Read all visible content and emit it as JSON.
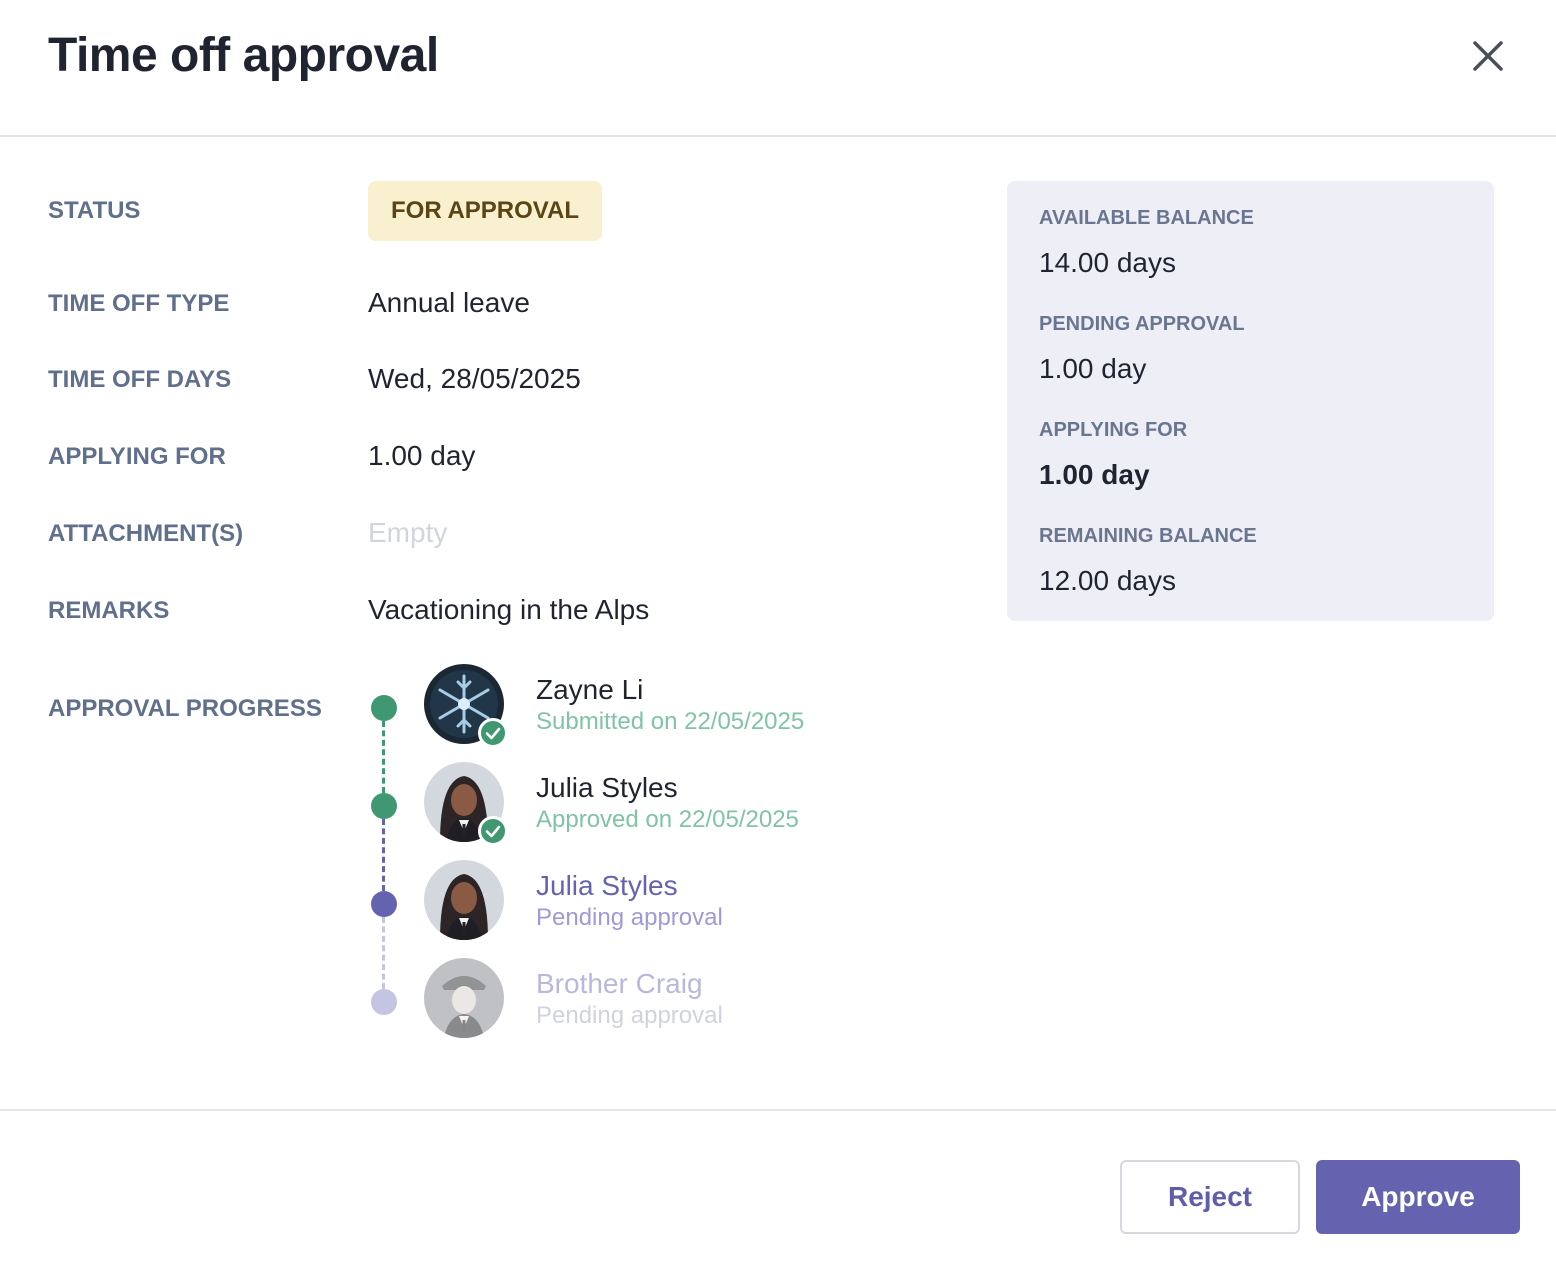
{
  "dialog": {
    "title": "Time off approval"
  },
  "fields": {
    "status_label": "STATUS",
    "status_value": "FOR APPROVAL",
    "type_label": "TIME OFF TYPE",
    "type_value": "Annual leave",
    "days_label": "TIME OFF DAYS",
    "days_value": "Wed, 28/05/2025",
    "applying_label": "APPLYING FOR",
    "applying_value": "1.00 day",
    "attachments_label": "ATTACHMENT(S)",
    "attachments_value": "Empty",
    "remarks_label": "REMARKS",
    "remarks_value": "Vacationing in the Alps",
    "progress_label": "APPROVAL PROGRESS"
  },
  "balance": {
    "available_label": "AVAILABLE BALANCE",
    "available_value": "14.00 days",
    "pending_label": "PENDING APPROVAL",
    "pending_value": "1.00 day",
    "applying_label": "APPLYING FOR",
    "applying_value": "1.00 day",
    "remaining_label": "REMAINING BALANCE",
    "remaining_value": "12.00 days"
  },
  "approvers": [
    {
      "name": "Zayne Li",
      "status": "Submitted on 22/05/2025",
      "state": "done"
    },
    {
      "name": "Julia Styles",
      "status": "Approved on 22/05/2025",
      "state": "done"
    },
    {
      "name": "Julia Styles",
      "status": "Pending approval",
      "state": "current"
    },
    {
      "name": "Brother Craig",
      "status": "Pending approval",
      "state": "upcoming"
    }
  ],
  "actions": {
    "reject_label": "Reject",
    "approve_label": "Approve"
  },
  "colors": {
    "done": "#3f9871",
    "done_text": "#7fc4a4",
    "current": "#6563b0",
    "current_text": "#9f9ad6",
    "upcoming": "#c4c5e2",
    "upcoming_text": "#b9b8dc",
    "badge_bg": "#f8f0cf",
    "card_bg": "#eeeff6"
  }
}
